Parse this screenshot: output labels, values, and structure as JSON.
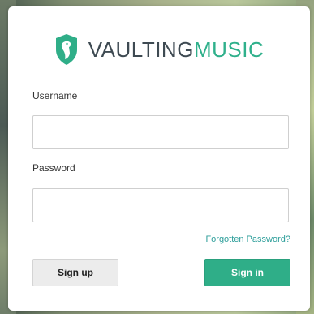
{
  "brand": {
    "name_part1": "VAULTING",
    "name_part2": "MUSIC",
    "logo_icon": "shield-bird-icon"
  },
  "form": {
    "username_label": "Username",
    "username_value": "",
    "password_label": "Password",
    "password_value": "",
    "forgot_link": "Forgotten Password?",
    "signup_label": "Sign up",
    "signin_label": "Sign in"
  },
  "colors": {
    "accent_green": "#2fae88",
    "brand_dark": "#3e4a52",
    "link_teal": "#2d9e9a"
  }
}
